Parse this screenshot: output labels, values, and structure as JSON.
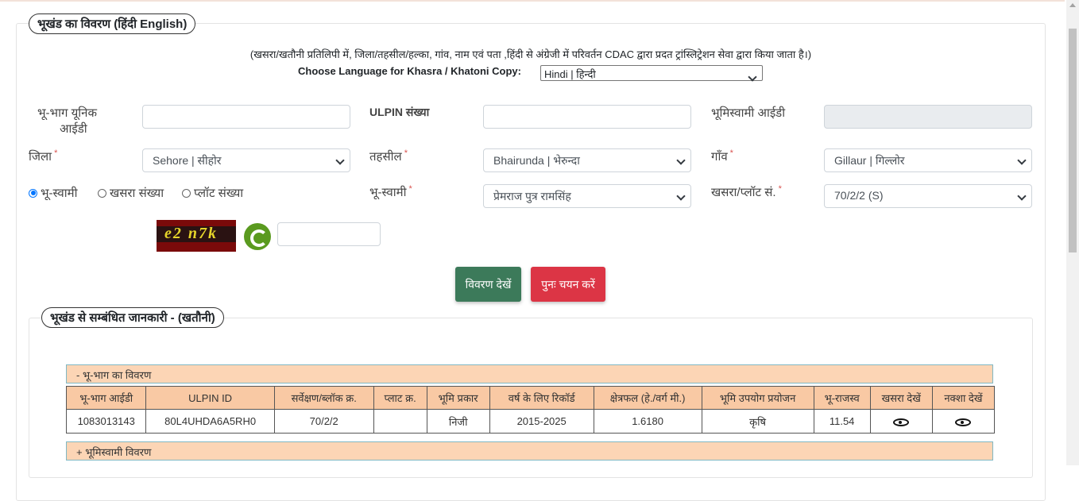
{
  "section1": {
    "title": "भूखंड का विवरण  (हिंदी  English)"
  },
  "notice": "(खसरा/खतौनी प्रतिलिपी में, जिला/तहसील/हल्का, गांव, नाम एवं पता ,हिंदी से अंग्रेजी में परिवर्तन CDAC द्वारा प्रदत ट्रांस्लिट्रेशन सेवा द्वारा किया जाता है।)",
  "language": {
    "label": "Choose Language for Khasra / Khatoni Copy:",
    "selected": "Hindi | हिन्दी"
  },
  "fields": {
    "unique_id_label_1": "भू-भाग      यूनिक",
    "unique_id_label_2": "आईडी",
    "unique_id_value": "",
    "ulpin_label": "ULPIN संख्या",
    "ulpin_value": "",
    "owner_id_label": "भूमिस्वामी आईडी",
    "owner_id_value": "",
    "district_label": "जिला",
    "district_value": "Sehore | सीहोर",
    "tehsil_label": "तहसील",
    "tehsil_value": "Bhairunda | भेरुन्दा",
    "village_label": "गाँव",
    "village_value": "Gillaur | गिल्लोर",
    "owner_label": "भू-स्वामी",
    "owner_value": "प्रेमराज पुत्र रामसिंह",
    "khasra_label": "खसरा/प्लॉट सं.",
    "khasra_value": "70/2/2 (S)",
    "required_mark": "*"
  },
  "search_by": [
    "भू-स्वामी",
    "खसरा संख्या",
    "प्लॉट संख्या"
  ],
  "captcha": {
    "text": "e2 n7k",
    "input_value": ""
  },
  "buttons": {
    "view": "विवरण देखें",
    "reset": "पुनः चयन करें"
  },
  "colors": {
    "view_button": "#3c7a5a",
    "reset_button": "#dc3545",
    "header_bg": "#f9c9a4"
  },
  "section2": {
    "title": "भूखंड से सम्बंधित जानकारी -   (खतौनी)"
  },
  "land_panel": {
    "title": "- भू-भाग का विवरण"
  },
  "table": {
    "headers": [
      "भू-भाग आईडी",
      "ULPIN ID",
      "सर्वेक्षण/ब्लॉक क्र.",
      "प्लाट क्र.",
      "भूमि प्रकार",
      "वर्ष के लिए रिकॉर्ड",
      "क्षेत्रफल (हे./वर्ग मी.)",
      "भूमि उपयोग प्रयोजन",
      "भू-राजस्व",
      "खसरा देखें",
      "नक्शा देखें"
    ],
    "rows": [
      [
        "1083013143",
        "80L4UHDA6A5RH0",
        "70/2/2",
        "",
        "निजी",
        "2015-2025",
        "1.6180",
        "कृषि",
        "11.54"
      ]
    ]
  },
  "owner_panel": {
    "title": "+ भूमिस्वामी विवरण"
  }
}
